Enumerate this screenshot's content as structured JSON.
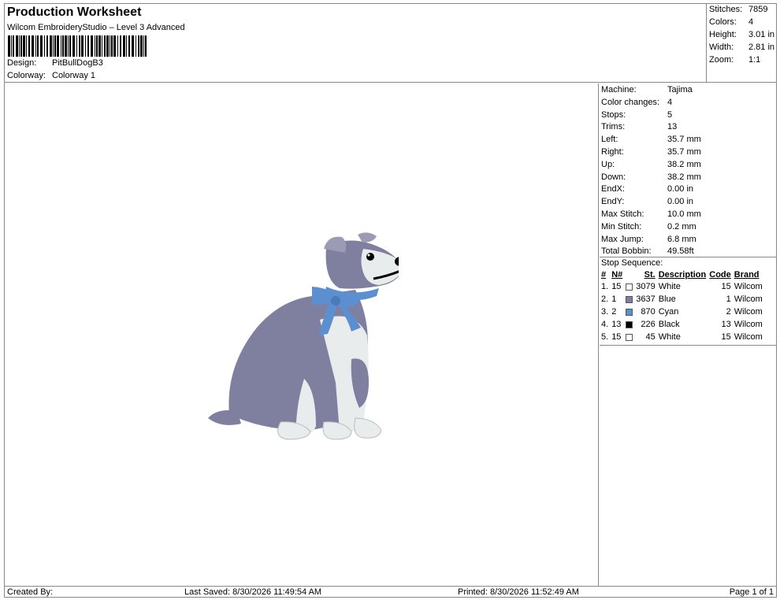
{
  "header": {
    "title": "Production Worksheet",
    "subtitle": "Wilcom EmbroideryStudio – Level 3 Advanced",
    "design_label": "Design:",
    "design_value": "PitBullDogB3",
    "colorway_label": "Colorway:",
    "colorway_value": "Colorway 1"
  },
  "summary": {
    "stitches_label": "Stitches:",
    "stitches": "7859",
    "colors_label": "Colors:",
    "colors": "4",
    "height_label": "Height:",
    "height": "3.01 in",
    "width_label": "Width:",
    "width": "2.81 in",
    "zoom_label": "Zoom:",
    "zoom": "1:1"
  },
  "machine": {
    "rows": [
      {
        "k": "Machine:",
        "v": "Tajima"
      },
      {
        "k": "Color changes:",
        "v": "4"
      },
      {
        "k": "Stops:",
        "v": "5"
      },
      {
        "k": "Trims:",
        "v": "13"
      },
      {
        "k": "Left:",
        "v": "35.7 mm"
      },
      {
        "k": "Right:",
        "v": "35.7 mm"
      },
      {
        "k": "Up:",
        "v": "38.2 mm"
      },
      {
        "k": "Down:",
        "v": "38.2 mm"
      },
      {
        "k": "EndX:",
        "v": "0.00 in"
      },
      {
        "k": "EndY:",
        "v": "0.00 in"
      },
      {
        "k": "Max Stitch:",
        "v": "10.0 mm"
      },
      {
        "k": "Min Stitch:",
        "v": "0.2 mm"
      },
      {
        "k": "Max Jump:",
        "v": "6.8 mm"
      },
      {
        "k": "Total Bobbin:",
        "v": "49.58ft"
      }
    ]
  },
  "stop_sequence": {
    "title": "Stop Sequence:",
    "headers": {
      "idx": "#",
      "n": "N#",
      "st": "St.",
      "desc": "Description",
      "code": "Code",
      "brand": "Brand"
    },
    "rows": [
      {
        "idx": "1.",
        "n": "15",
        "color": "#ffffff",
        "st": "3079",
        "desc": "White",
        "code": "15",
        "brand": "Wilcom"
      },
      {
        "idx": "2.",
        "n": "1",
        "color": "#7f7f9f",
        "st": "3637",
        "desc": "Blue",
        "code": "1",
        "brand": "Wilcom"
      },
      {
        "idx": "3.",
        "n": "2",
        "color": "#5b8fcf",
        "st": "870",
        "desc": "Cyan",
        "code": "2",
        "brand": "Wilcom"
      },
      {
        "idx": "4.",
        "n": "13",
        "color": "#000000",
        "st": "226",
        "desc": "Black",
        "code": "13",
        "brand": "Wilcom"
      },
      {
        "idx": "5.",
        "n": "15",
        "color": "#ffffff",
        "st": "45",
        "desc": "White",
        "code": "15",
        "brand": "Wilcom"
      }
    ]
  },
  "footer": {
    "created_by": "Created By:",
    "last_saved": "Last Saved: 8/30/2026 11:49:54 AM",
    "printed": "Printed: 8/30/2026 11:52:49 AM",
    "page": "Page 1 of 1"
  },
  "colors": {
    "dog_gray": "#7f7f9f",
    "dog_white": "#e8ecec",
    "bow": "#5b8fcf"
  }
}
